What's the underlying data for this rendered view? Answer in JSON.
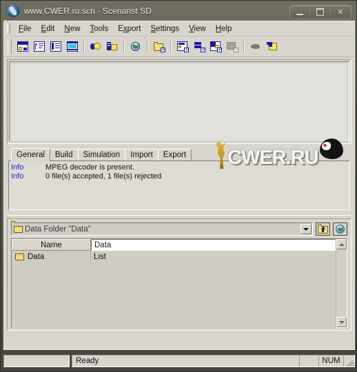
{
  "window": {
    "title": "www.CWER.ru.scn - Scenarist SD",
    "app_icon": "scenarist-logo-icon",
    "controls": {
      "minimize": "minimize-icon",
      "maximize": "maximize-icon",
      "close": "✕"
    }
  },
  "menu": {
    "items": [
      {
        "pre": "",
        "mnemonic": "F",
        "post": "ile"
      },
      {
        "pre": "",
        "mnemonic": "E",
        "post": "dit"
      },
      {
        "pre": "",
        "mnemonic": "N",
        "post": "ew"
      },
      {
        "pre": "",
        "mnemonic": "T",
        "post": "ools"
      },
      {
        "pre": "E",
        "mnemonic": "x",
        "post": "port"
      },
      {
        "pre": "",
        "mnemonic": "S",
        "post": "ettings"
      },
      {
        "pre": "",
        "mnemonic": "V",
        "post": "iew"
      },
      {
        "pre": "",
        "mnemonic": "H",
        "post": "elp"
      }
    ]
  },
  "toolbar": {
    "buttons": [
      {
        "name": "track-editor-button",
        "icon": "track-editor-icon"
      },
      {
        "name": "scenario-editor-button",
        "icon": "scenario-editor-icon"
      },
      {
        "name": "list-editor-button",
        "icon": "list-editor-icon"
      },
      {
        "name": "preview-monitor-button",
        "icon": "preview-monitor-icon"
      },
      {
        "name": "layout-editor-button",
        "icon": "pac-layout-icon"
      },
      {
        "name": "properties-button",
        "icon": "properties-icon"
      },
      {
        "name": "simulation-button",
        "icon": "simulation-globe-icon"
      },
      {
        "name": "new-data-folder-button",
        "icon": "folder-add-icon"
      },
      {
        "name": "new-video-track-button",
        "icon": "video-add-icon"
      },
      {
        "name": "new-audio-track-button",
        "icon": "audio-add-icon"
      },
      {
        "name": "new-subtitle-track-button",
        "icon": "subtitle-add-icon"
      },
      {
        "name": "new-highlight-button",
        "icon": "highlight-add-icon-disabled"
      },
      {
        "name": "mouse-tool-button",
        "icon": "pointer-blob-icon"
      },
      {
        "name": "import-asset-button",
        "icon": "import-folder-icon"
      }
    ]
  },
  "top_pane": {
    "name": "editor-workspace",
    "content": ""
  },
  "tabs": {
    "items": [
      {
        "label": "General",
        "active": true
      },
      {
        "label": "Build",
        "active": false
      },
      {
        "label": "Simulation",
        "active": false
      },
      {
        "label": "Import",
        "active": false
      },
      {
        "label": "Export",
        "active": false
      }
    ],
    "log": [
      {
        "tag": "Info",
        "message": "MPEG decoder is present."
      },
      {
        "tag": "Info",
        "message": "0 file(s) accepted, 1 file(s) rejected"
      }
    ]
  },
  "watermark": {
    "text": "CWER.RU"
  },
  "data_panel": {
    "folder_combo": {
      "value": "Data Folder \"Data\"",
      "icon": "folder-open-icon",
      "arrow_icon": "chevron-down-icon"
    },
    "buttons": [
      {
        "name": "go-up-folder-button",
        "icon": "folder-up-icon"
      },
      {
        "name": "globe-properties-button",
        "icon": "globe-icon"
      }
    ],
    "columns": [
      "Name",
      "Data"
    ],
    "name_value": "Data",
    "rows": [
      {
        "icon": "folder-icon",
        "name": "Data",
        "value": "List"
      }
    ],
    "scrollbar": {
      "up": "scroll-up-icon",
      "down": "scroll-down-icon"
    }
  },
  "statusbar": {
    "message": "Ready",
    "indicators": [
      "",
      "NUM"
    ]
  }
}
